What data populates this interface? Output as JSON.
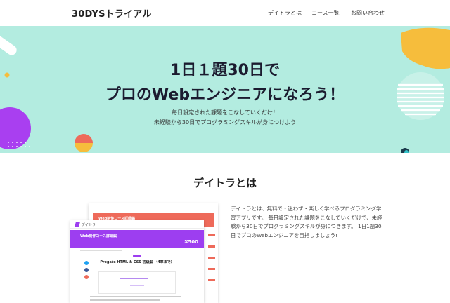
{
  "header": {
    "logo": "30DYSトライアル",
    "nav": [
      "デイトラとは",
      "コース一覧",
      "お問い合わせ"
    ]
  },
  "hero": {
    "title_line1": "1日１題30日で",
    "title_line2": "プロのWebエンジニアになろう！",
    "subtitle_line1": "毎日設定された課題をこなしていくだけ！",
    "subtitle_line2": "未経験から30日でプログラミングスキルが身につけよう"
  },
  "about": {
    "title": "デイトラとは",
    "text": "デイトラとは、無料で・迷わず・楽しく学べるプログラミング学習アプリです。 毎日設定された課題をこなしていくだけで、未経験から30日でプログラミングスキルが身につきます。 1日1題30日でプロのWebエンジニアを目指しましょう!"
  },
  "mockup": {
    "back_banner": "Web制作コース詳細編",
    "front_brand": "デイトラ",
    "front_banner_title": "Web制作コース詳細編",
    "front_price": "¥500",
    "course_title": "Progate HTML & CSS 初級編 （4章まで）"
  },
  "colors": {
    "hero_bg": "#b3ece0",
    "purple": "#9d3ef0",
    "coral": "#ee6a5a",
    "yellow": "#f6bd3c"
  }
}
